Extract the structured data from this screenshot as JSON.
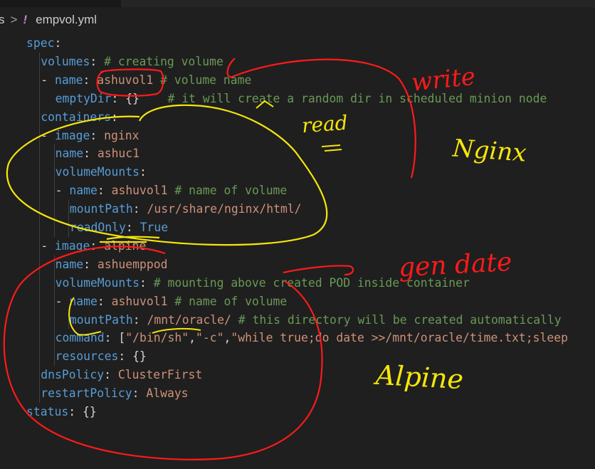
{
  "breadcrumb": {
    "parent": "s",
    "separator": ">",
    "file_icon": "!",
    "file_name": "empvol.yml"
  },
  "code_lines": [
    {
      "id": "spec",
      "indent": 0,
      "tokens": [
        {
          "t": "spec",
          "c": "k"
        },
        {
          "t": ":",
          "c": "p"
        }
      ]
    },
    {
      "id": "volumes",
      "indent": 1,
      "tokens": [
        {
          "t": "volumes",
          "c": "k"
        },
        {
          "t": ": ",
          "c": "p"
        },
        {
          "t": "# creating volume",
          "c": "c"
        }
      ]
    },
    {
      "id": "vol-name",
      "indent": 1,
      "tokens": [
        {
          "t": "- ",
          "c": "p"
        },
        {
          "t": "name",
          "c": "k"
        },
        {
          "t": ": ",
          "c": "p"
        },
        {
          "t": "ashuvol1",
          "c": "s"
        },
        {
          "t": " ",
          "c": "p"
        },
        {
          "t": "# volume name",
          "c": "c"
        }
      ]
    },
    {
      "id": "emptydir",
      "indent": 2,
      "tokens": [
        {
          "t": "emptyDir",
          "c": "k"
        },
        {
          "t": ": {}    ",
          "c": "p"
        },
        {
          "t": "# it will create a random dir in scheduled minion node",
          "c": "c"
        }
      ]
    },
    {
      "id": "containers",
      "indent": 1,
      "tokens": [
        {
          "t": "containers",
          "c": "k"
        },
        {
          "t": ":",
          "c": "p"
        }
      ]
    },
    {
      "id": "image-nginx",
      "indent": 1,
      "tokens": [
        {
          "t": "- ",
          "c": "p"
        },
        {
          "t": "image",
          "c": "k"
        },
        {
          "t": ": ",
          "c": "p"
        },
        {
          "t": "nginx",
          "c": "s"
        }
      ]
    },
    {
      "id": "name-ashuc1",
      "indent": 2,
      "tokens": [
        {
          "t": "name",
          "c": "k"
        },
        {
          "t": ": ",
          "c": "p"
        },
        {
          "t": "ashuc1",
          "c": "s"
        }
      ]
    },
    {
      "id": "volmounts-1",
      "indent": 2,
      "tokens": [
        {
          "t": "volumeMounts",
          "c": "k"
        },
        {
          "t": ":",
          "c": "p"
        }
      ]
    },
    {
      "id": "vm1-name",
      "indent": 2,
      "tokens": [
        {
          "t": "- ",
          "c": "p"
        },
        {
          "t": "name",
          "c": "k"
        },
        {
          "t": ": ",
          "c": "p"
        },
        {
          "t": "ashuvol1",
          "c": "s"
        },
        {
          "t": " ",
          "c": "p"
        },
        {
          "t": "# name of volume",
          "c": "c"
        }
      ]
    },
    {
      "id": "vm1-path",
      "indent": 3,
      "tokens": [
        {
          "t": "mountPath",
          "c": "k"
        },
        {
          "t": ": ",
          "c": "p"
        },
        {
          "t": "/usr/share/nginx/html/",
          "c": "s"
        }
      ]
    },
    {
      "id": "vm1-ro",
      "indent": 3,
      "tokens": [
        {
          "t": "readOnly",
          "c": "k"
        },
        {
          "t": ": ",
          "c": "p"
        },
        {
          "t": "True",
          "c": "b"
        }
      ]
    },
    {
      "id": "image-alpine",
      "indent": 1,
      "tokens": [
        {
          "t": "- ",
          "c": "p"
        },
        {
          "t": "image",
          "c": "k"
        },
        {
          "t": ": ",
          "c": "p"
        },
        {
          "t": "alpine",
          "c": "s"
        }
      ]
    },
    {
      "id": "name-emppod",
      "indent": 2,
      "tokens": [
        {
          "t": "name",
          "c": "k"
        },
        {
          "t": ": ",
          "c": "p"
        },
        {
          "t": "ashuemppod",
          "c": "s"
        }
      ]
    },
    {
      "id": "volmounts-2",
      "indent": 2,
      "tokens": [
        {
          "t": "volumeMounts",
          "c": "k"
        },
        {
          "t": ": ",
          "c": "p"
        },
        {
          "t": "# mounting above created POD inside container",
          "c": "c"
        }
      ]
    },
    {
      "id": "vm2-name",
      "indent": 2,
      "tokens": [
        {
          "t": "- ",
          "c": "p"
        },
        {
          "t": "name",
          "c": "k"
        },
        {
          "t": ": ",
          "c": "p"
        },
        {
          "t": "ashuvol1",
          "c": "s"
        },
        {
          "t": " ",
          "c": "p"
        },
        {
          "t": "# name of volume",
          "c": "c"
        }
      ]
    },
    {
      "id": "vm2-path",
      "indent": 3,
      "tokens": [
        {
          "t": "mountPath",
          "c": "k"
        },
        {
          "t": ": ",
          "c": "p"
        },
        {
          "t": "/mnt/oracle/",
          "c": "s"
        },
        {
          "t": " ",
          "c": "p"
        },
        {
          "t": "# this directory will be created automatically",
          "c": "c"
        }
      ]
    },
    {
      "id": "command",
      "indent": 2,
      "tokens": [
        {
          "t": "command",
          "c": "k"
        },
        {
          "t": ": [",
          "c": "p"
        },
        {
          "t": "\"/bin/sh\"",
          "c": "s"
        },
        {
          "t": ",",
          "c": "p"
        },
        {
          "t": "\"-c\"",
          "c": "s"
        },
        {
          "t": ",",
          "c": "p"
        },
        {
          "t": "\"while true;do date >>/mnt/oracle/time.txt;sleep",
          "c": "s"
        }
      ]
    },
    {
      "id": "resources",
      "indent": 2,
      "tokens": [
        {
          "t": "resources",
          "c": "k"
        },
        {
          "t": ": {}",
          "c": "p"
        }
      ]
    },
    {
      "id": "dnspolicy",
      "indent": 1,
      "tokens": [
        {
          "t": "dnsPolicy",
          "c": "k"
        },
        {
          "t": ": ",
          "c": "p"
        },
        {
          "t": "ClusterFirst",
          "c": "s"
        }
      ]
    },
    {
      "id": "restartpolicy",
      "indent": 1,
      "tokens": [
        {
          "t": "restartPolicy",
          "c": "k"
        },
        {
          "t": ": ",
          "c": "p"
        },
        {
          "t": "Always",
          "c": "s"
        }
      ]
    },
    {
      "id": "status",
      "indent": 0,
      "tokens": [
        {
          "t": "status",
          "c": "k"
        },
        {
          "t": ": {}",
          "c": "p"
        }
      ]
    }
  ],
  "handwritten_notes": {
    "write": "write",
    "read": "read",
    "nginx": "Nginx",
    "gen_date": "gen date",
    "alpine": "Alpine"
  },
  "colors": {
    "background": "#1f1f1f",
    "key": "#569cd6",
    "string": "#ce9178",
    "comment": "#6a9955",
    "punctuation": "#d4d4d4",
    "red_ink": "#ff1a1a",
    "yellow_ink": "#f5e60a"
  }
}
